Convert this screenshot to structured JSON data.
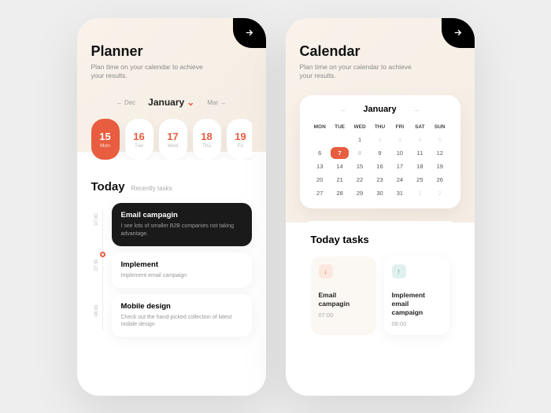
{
  "planner": {
    "title": "Planner",
    "subtitle": "Plan time on your calendar to achieve your results.",
    "prev_month": "← Dec",
    "current_month": "January",
    "next_month": "Mar →",
    "days": [
      {
        "num": "15",
        "dow": "Mon"
      },
      {
        "num": "16",
        "dow": "Tue"
      },
      {
        "num": "17",
        "dow": "Wed"
      },
      {
        "num": "18",
        "dow": "Thu"
      },
      {
        "num": "19",
        "dow": "Fri"
      }
    ],
    "today_title": "Today",
    "today_sub": "Recently tasks",
    "timeline": [
      {
        "time": "07:00",
        "title": "Email campagin",
        "desc": "I see lots of smaller B2B companies not taking advantage."
      },
      {
        "time": "07:30",
        "title": "Implement",
        "desc": "Implement email campaign"
      },
      {
        "time": "08:00",
        "title": "Mobile design",
        "desc": "Check out the hand-picked collection of latest mobile design"
      }
    ]
  },
  "calendar": {
    "title": "Calendar",
    "subtitle": "Plan time on your calendar to achieve your results.",
    "month": "January",
    "weekdays": [
      "MON",
      "TUE",
      "WED",
      "THU",
      "FRI",
      "SAT",
      "SUN"
    ],
    "cells": [
      {
        "n": "",
        "m": 1
      },
      {
        "n": "",
        "m": 1
      },
      {
        "n": "1",
        "m": 0
      },
      {
        "n": "2",
        "m": 1
      },
      {
        "n": "3",
        "m": 1
      },
      {
        "n": "4",
        "m": 1
      },
      {
        "n": "5",
        "m": 1
      },
      {
        "n": "6",
        "m": 0
      },
      {
        "n": "7",
        "m": 0,
        "sel": 1
      },
      {
        "n": "8",
        "m": 0,
        "t": 1
      },
      {
        "n": "9",
        "m": 0
      },
      {
        "n": "10",
        "m": 0
      },
      {
        "n": "11",
        "m": 0
      },
      {
        "n": "12",
        "m": 0
      },
      {
        "n": "13",
        "m": 0
      },
      {
        "n": "14",
        "m": 0
      },
      {
        "n": "15",
        "m": 0
      },
      {
        "n": "16",
        "m": 0
      },
      {
        "n": "17",
        "m": 0
      },
      {
        "n": "18",
        "m": 0
      },
      {
        "n": "19",
        "m": 0
      },
      {
        "n": "20",
        "m": 0
      },
      {
        "n": "21",
        "m": 0
      },
      {
        "n": "22",
        "m": 0
      },
      {
        "n": "23",
        "m": 0
      },
      {
        "n": "24",
        "m": 0
      },
      {
        "n": "25",
        "m": 0
      },
      {
        "n": "26",
        "m": 0
      },
      {
        "n": "27",
        "m": 0
      },
      {
        "n": "28",
        "m": 0
      },
      {
        "n": "29",
        "m": 0
      },
      {
        "n": "30",
        "m": 0
      },
      {
        "n": "31",
        "m": 0
      },
      {
        "n": "1",
        "m": 1
      },
      {
        "n": "2",
        "m": 1
      }
    ],
    "tasks_title": "Today tasks",
    "cards": [
      {
        "title": "Email campagin",
        "time": "07:00",
        "dir": "down"
      },
      {
        "title": "Implement email campaign",
        "time": "08:00",
        "dir": "up"
      }
    ]
  }
}
